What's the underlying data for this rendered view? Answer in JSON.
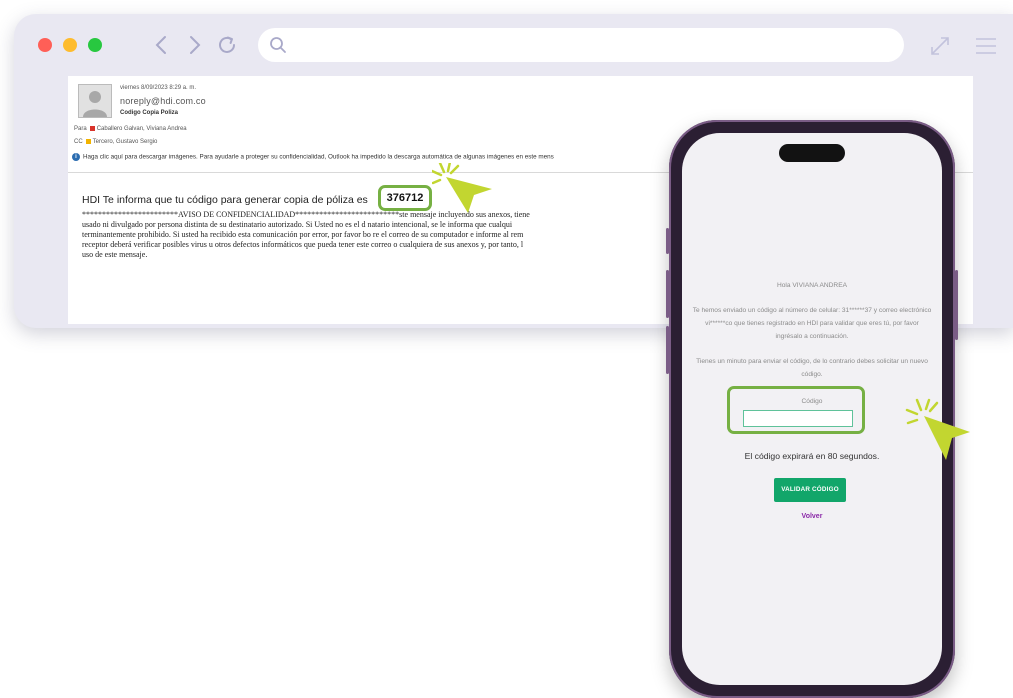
{
  "browser": {
    "url_placeholder": "",
    "icons": [
      "back-icon",
      "forward-icon",
      "reload-icon",
      "search-icon",
      "expand-icon",
      "menu-icon"
    ]
  },
  "email": {
    "date": "viernes 8/09/2023 8:29 a. m.",
    "sender": "noreply@hdi.com.co",
    "subject": "Codigo Copia Poliza",
    "to_label": "Para",
    "to_name": "Caballero Galvan, Viviana Andrea",
    "cc_label": "CC",
    "cc_name": "Tercero, Gustavo Sergio",
    "info_notice": "Haga clic aquí para descargar imágenes. Para ayudarle a proteger su confidencialidad, Outlook ha impedido la descarga automática de algunas imágenes en este mens",
    "message": "HDI Te informa que tu código para generar copia de póliza es",
    "code": "376712",
    "legal_lines": [
      "************************AVISO DE CONFIDENCIALIDAD**************************ste mensaje incluyendo sus anexos, tiene",
      "usado ni divulgado por persona distinta de su destinatario autorizado. Si Usted no es el d     natario intencional, se le informa que cualqui",
      "terminantemente prohibido. Si usted ha recibido esta comunicación por error, por favor bo   re el correo de su computador e informe al rem",
      "receptor deberá verificar posibles virus u otros defectos informáticos que pueda tener este correo o cualquiera de sus anexos y, por tanto, l",
      "uso de este mensaje."
    ]
  },
  "phone": {
    "greeting": "Hola VIVIANA ANDREA",
    "sent_info": "Te hemos enviado un código al número de celular: 31******37 y correo electrónico vi******co que tienes registrado en HDI para validar que eres tú, por favor ingrésalo a continuación.",
    "minute_info": "Tienes un minuto para enviar el código, de lo contrario debes solicitar un nuevo código.",
    "code_label": "Código",
    "code_value": "",
    "expire_text": "El código expirará en 80 segundos.",
    "validate_button": "VALIDAR CÓDIGO",
    "back_link": "Volver"
  },
  "colors": {
    "highlight": "#76b043",
    "cursor": "#c2d630",
    "validate_button": "#12a66a",
    "back_link": "#8b2aa8",
    "phone_frame": "#2b1f33"
  }
}
